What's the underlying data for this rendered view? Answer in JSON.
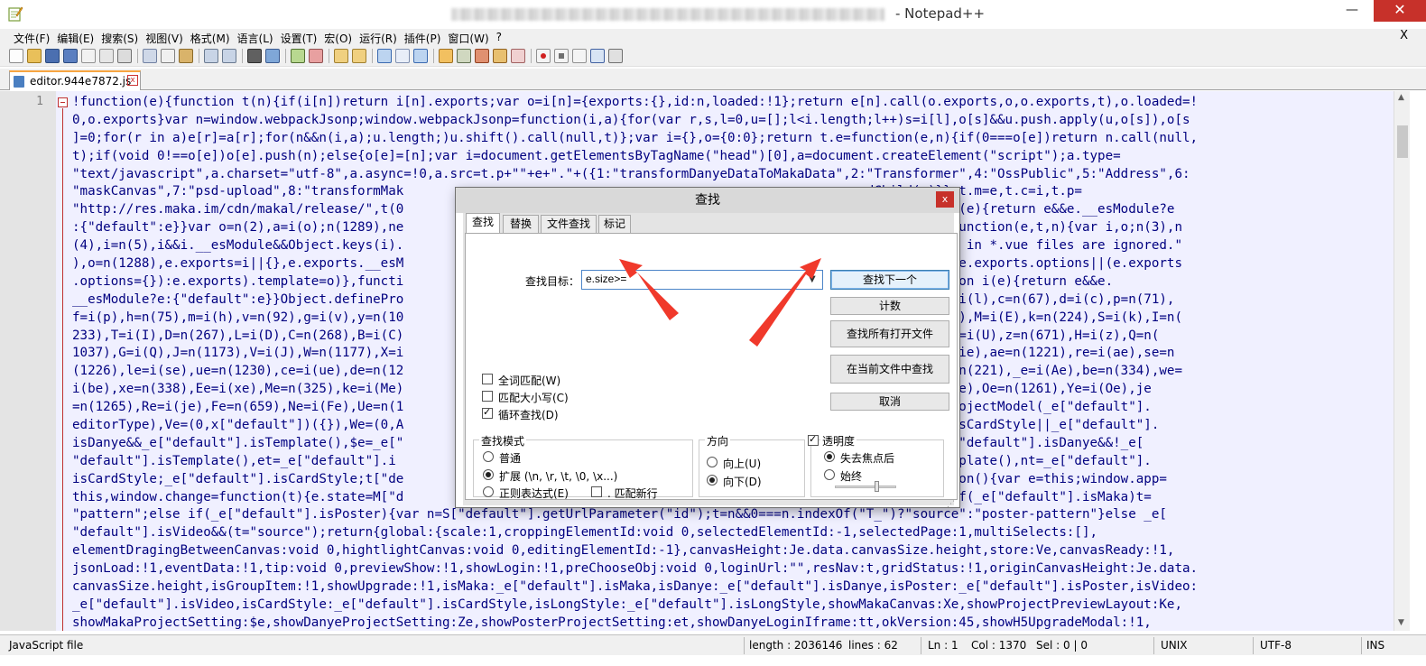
{
  "window": {
    "title": "- Notepad++",
    "minimize": "—",
    "close": "✕"
  },
  "menu": {
    "items": [
      "文件(F)",
      "编辑(E)",
      "搜索(S)",
      "视图(V)",
      "格式(M)",
      "语言(L)",
      "设置(T)",
      "宏(O)",
      "运行(R)",
      "插件(P)",
      "窗口(W)",
      "?"
    ],
    "close": "X"
  },
  "toolbar": {
    "icons": [
      "new-file-icon",
      "open-file-icon",
      "save-icon",
      "save-all-icon",
      "close-icon",
      "close-all-icon",
      "print-icon",
      "cut-icon",
      "copy-icon",
      "paste-icon",
      "undo-icon",
      "redo-icon",
      "find-icon",
      "replace-icon",
      "zoom-in-icon",
      "zoom-out-icon",
      "sync-v-icon",
      "sync-h-icon",
      "word-wrap-icon",
      "show-all-chars-icon",
      "indent-guide-icon",
      "udl-icon",
      "doc-map-icon",
      "function-list-icon",
      "folder-workspace-icon",
      "monitor-icon",
      "record-macro-icon",
      "stop-macro-icon",
      "play-macro-icon",
      "run-macro-multiple-icon",
      "save-macro-icon"
    ]
  },
  "tab": {
    "label": "editor.944e7872.js",
    "close": "x"
  },
  "editor": {
    "line_number": "1",
    "lines": [
      "!function(e){function t(n){if(i[n])return i[n].exports;var o=i[n]={exports:{},id:n,loaded:!1};return e[n].call(o.exports,o,o.exports,t),o.loaded=!",
      "0,o.exports}var n=window.webpackJsonp;window.webpackJsonp=function(i,a){for(var r,s,l=0,u=[];l<i.length;l++)s=i[l],o[s]&&u.push.apply(u,o[s]),o[s",
      "]=0;for(r in a)e[r]=a[r];for(n&&n(i,a);u.length;)u.shift().call(null,t)};var i={},o={0:0};return t.e=function(e,n){if(0===o[e])return n.call(null,",
      "t);if(void 0!==o[e])o[e].push(n);else{o[e]=[n];var i=document.getElementsByTagName(\"head\")[0],a=document.createElement(\"script\");a.type=",
      "\"text/javascript\",a.charset=\"utf-8\",a.async=!0,a.src=t.p+\"\"+e+\".\"+({1:\"transformDanyeDataToMakaData\",2:\"Transformer\",4:\"OssPublic\",5:\"Address\",6:",
      "\"maskCanvas\",7:\"psd-upload\",8:\"transformMak                                                      .appendChild(a)}},t.m=e,t.c=i,t.p=",
      "\"http://res.maka.im/cdn/makal/release/\",t(0                                                      strict\";function i(e){return e&&e.__esModule?e",
      ":{\"default\":e}}var o=n(2),a=i(o);n(1289),ne                                                      fig.devtools=!0},function(e,t,n){var i,o;n(3),n",
      "(4),i=n(5),i&&i.__esModule&&Object.keys(i).                                                      vue: named exports in *.vue files are ignored.\"",
      "),o=n(1288),e.exports=i||{},e.exports.__esM                                                      =typeof e.exports?e.exports.options||(e.exports",
      ".options={}):e.exports).template=o)},functi                                                      use strict\";function i(e){return e&&e.",
      "__esModule?e:{\"default\":e}}Object.definePro                                                      ,s=i(r),l=n(45),u=i(l),c=n(67),d=i(c),p=n(71),",
      "f=i(p),h=n(75),m=i(h),v=n(92),g=i(v),y=n(10                                                      48),x=i(w),E=n(128),M=i(E),k=n(224),S=i(k),I=n(",
      "233),T=i(I),D=n(267),L=i(D),C=n(268),B=i(C)                                                      ,N=i(F),U=n(610),q=i(U),z=n(671),H=i(z),Q=n(",
      "1037),G=i(Q),J=n(1173),V=i(J),W=n(1177),X=i                                                      ),ie=n(1195),oe=i(ie),ae=n(1221),re=i(ae),se=n",
      "(1226),le=i(se),ue=n(1230),ce=i(ue),de=n(12                                                      (299),ye=i(ge),Ae=n(221),_e=i(Ae),be=n(334),we=",
      "i(be),xe=n(338),Ee=i(xe),Me=n(325),ke=i(Me)                                                      ,Le=n(1257),Pe=i(Be),Oe=n(1261),Ye=i(Oe),je",
      "=n(1265),Re=i(je),Fe=n(659),Ne=i(Fe),Ue=n(1                                                      S[\"default\"].getProjectModel(_e[\"default\"].",
      "editorType),Ve=(0,x[\"default\"])({}),We=(0,A                                                      Xe=_e[\"default\"].isCardStyle||_e[\"default\"].",
      "isDanye&&_e[\"default\"].isTemplate(),$e=_e[\"                                                      sTemplate(),Ze=_e[\"default\"].isDanye&&!_e[",
      "\"default\"].isTemplate(),et=_e[\"default\"].i                                                      _e[\"default\"].isTemplate(),nt=_e[\"default\"].",
      "isCardStyle;_e[\"default\"].isCardStyle;t[\"de                                                      ult\"]],data:function(){var e=this;window.app=",
      "this,window.change=function(t){e.state=M[\"d                                                      e)t=\"group\";else if(_e[\"default\"].isMaka)t=",
      "\"pattern\";else if(_e[\"default\"].isPoster){var n=S[\"default\"].getUrlParameter(\"id\");t=n&&0===n.indexOf(\"T_\")?\"source\":\"poster-pattern\"}else _e[",
      "\"default\"].isVideo&&(t=\"source\");return{global:{scale:1,croppingElementId:void 0,selectedElementId:-1,selectedPage:1,multiSelects:[],",
      "elementDragingBetweenCanvas:void 0,hightlightCanvas:void 0,editingElementId:-1},canvasHeight:Je.data.canvasSize.height,store:Ve,canvasReady:!1,",
      "jsonLoad:!1,eventData:!1,tip:void 0,previewShow:!1,showLogin:!1,preChooseObj:void 0,loginUrl:\"\",resNav:t,gridStatus:!1,originCanvasHeight:Je.data.",
      "canvasSize.height,isGroupItem:!1,showUpgrade:!1,isMaka:_e[\"default\"].isMaka,isDanye:_e[\"default\"].isDanye,isPoster:_e[\"default\"].isPoster,isVideo:",
      "_e[\"default\"].isVideo,isCardStyle:_e[\"default\"].isCardStyle,isLongStyle:_e[\"default\"].isLongStyle,showMakaCanvas:Xe,showProjectPreviewLayout:Ke,",
      "showMakaProjectSetting:$e,showDanyeProjectSetting:Ze,showPosterProjectSetting:et,showDanyeLoginIframe:tt,okVersion:45,showH5UpgradeModal:!1,"
    ]
  },
  "statusbar": {
    "file_type": "JavaScript file",
    "length": "length : 2036146",
    "lines": "lines : 62",
    "ln": "Ln : 1",
    "col": "Col : 1370",
    "sel": "Sel : 0 | 0",
    "eol": "UNIX",
    "encoding": "UTF-8",
    "mode": "INS"
  },
  "find_dialog": {
    "title": "查找",
    "close": "x",
    "tabs": [
      "查找",
      "替换",
      "文件查找",
      "标记"
    ],
    "target_label": "查找目标：",
    "target_value": "e.size>=",
    "buttons": {
      "find_next": "查找下一个",
      "count": "计数",
      "find_all_open": "查找所有打开文件",
      "find_in_current": "在当前文件中查找",
      "cancel": "取消"
    },
    "options": {
      "whole_word": "全词匹配(W)",
      "match_case": "匹配大小写(C)",
      "wrap_around": "循环查找(D)"
    },
    "search_mode": {
      "title": "查找模式",
      "normal": "普通",
      "extended": "扩展 (\\n, \\r, \\t, \\0, \\x...)",
      "regex": "正则表达式(E)",
      "dot_newline": ". 匹配新行"
    },
    "direction": {
      "title": "方向",
      "up": "向上(U)",
      "down": "向下(D)"
    },
    "transparency": {
      "title": "透明度",
      "on_lose_focus": "失去焦点后",
      "always": "始终",
      "level": 0.65
    }
  },
  "colors": {
    "accent_arrow": "#f0392b",
    "editor_bg": "#f0f0ff",
    "code_text": "#000080",
    "selection_border": "#4c85c8"
  }
}
